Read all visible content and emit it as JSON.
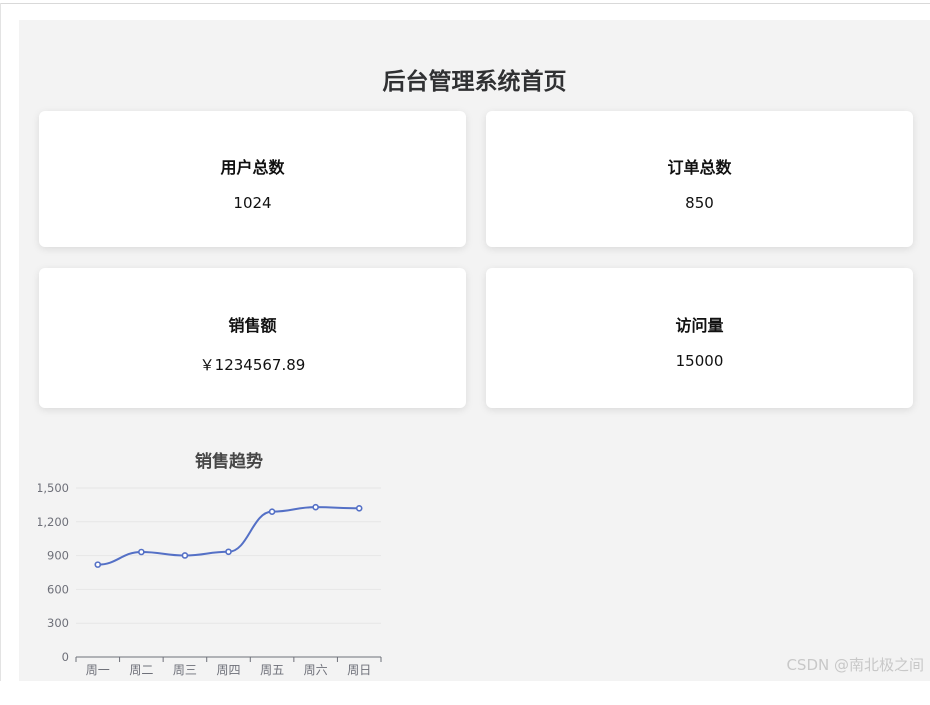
{
  "page": {
    "title": "后台管理系统首页"
  },
  "stats": [
    {
      "label": "用户总数",
      "value": "1024"
    },
    {
      "label": "订单总数",
      "value": "850"
    },
    {
      "label": "销售额",
      "value": "￥1234567.89"
    },
    {
      "label": "访问量",
      "value": "15000"
    }
  ],
  "chart_data": {
    "type": "line",
    "title": "销售趋势",
    "categories": [
      "周一",
      "周二",
      "周三",
      "周四",
      "周五",
      "周六",
      "周日"
    ],
    "values": [
      820,
      932,
      901,
      934,
      1290,
      1330,
      1320
    ],
    "ylim": [
      0,
      1500
    ],
    "yticks": [
      "0",
      "300",
      "600",
      "900",
      "1,200",
      "1,500"
    ],
    "smooth": true,
    "grid": true,
    "color": "#5470c6"
  },
  "watermark": "CSDN @南北极之间"
}
